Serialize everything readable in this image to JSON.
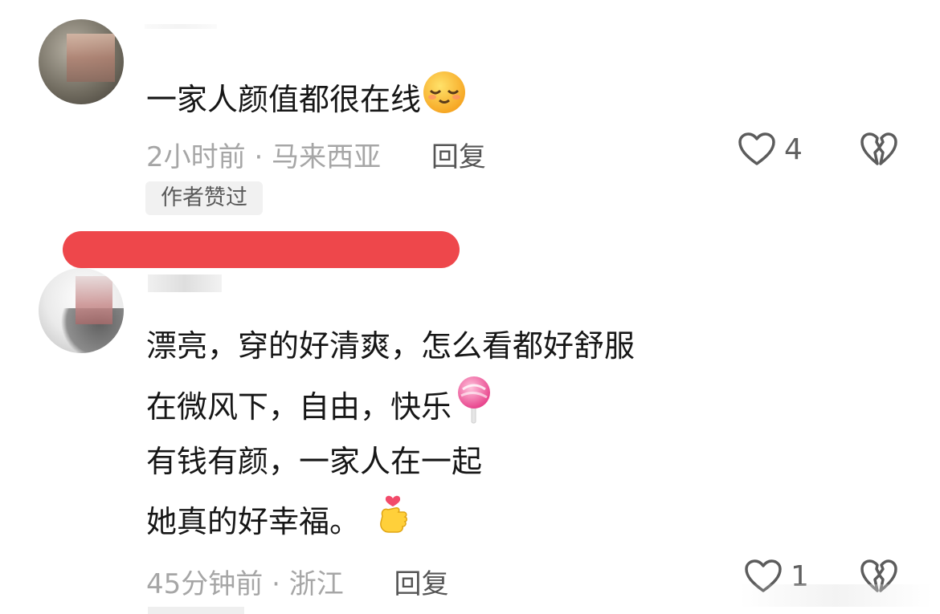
{
  "comments": [
    {
      "text": "一家人颜值都很在线",
      "time": "2小时前",
      "separator": "·",
      "location": "马来西亚",
      "reply_label": "回复",
      "likes": "4",
      "badge": "作者赞过",
      "emoji": "smiling-face-icon"
    },
    {
      "lines": [
        "漂亮，穿的好清爽，怎么看都好舒服",
        "在微风下，自由，快乐",
        "有钱有颜，一家人在一起",
        "她真的好幸福。"
      ],
      "time": "45分钟前",
      "separator": "·",
      "location": "浙江",
      "reply_label": "回复",
      "likes": "1",
      "emojis": [
        "lollipop-icon",
        "finger-heart-icon"
      ]
    }
  ],
  "colors": {
    "redaction": "#ee474b",
    "meta_text": "#a6a6a6",
    "reply_text": "#555555"
  }
}
